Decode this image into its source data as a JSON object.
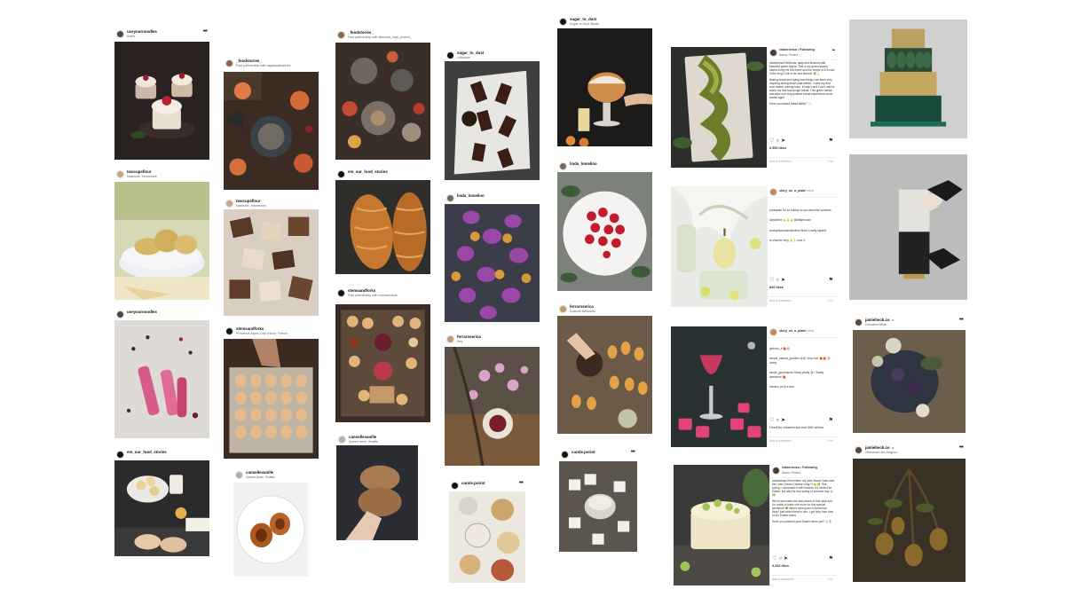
{
  "posts": [
    {
      "user": "useyournoodles",
      "sub": "Kiss's"
    },
    {
      "user": "twocupsflour",
      "sub": "Nashville, Tennessee"
    },
    {
      "user": "useyournoodles",
      "sub": ""
    },
    {
      "user": "em_our_food_stories",
      "sub": ""
    },
    {
      "user": "_foodstories_",
      "sub": "Paid partnership with sagaspatisseries"
    },
    {
      "user": "twocupsflour",
      "sub": "Nashville, Tennessee"
    },
    {
      "user": "stemsandforks",
      "sub": "Provence-Alpes-Côte d'Azur, France"
    },
    {
      "user": "cannellevanille",
      "sub": "Queen Anne, Seattle"
    },
    {
      "user": "_foodstories_",
      "sub": "Paid partnership with alimenta_high_protein_"
    },
    {
      "user": "em_our_food_stories",
      "sub": ""
    },
    {
      "user": "stemsandforks",
      "sub": "Paid partnership with memoemaria"
    },
    {
      "user": "cannellevanille",
      "sub": "Queen Anne, Seattle"
    },
    {
      "user": "sugar_to_dust",
      "sub": "Lithuania"
    },
    {
      "user": "linda_lomelino",
      "sub": ""
    },
    {
      "user": "ferraroserica",
      "sub": "Italy"
    },
    {
      "user": "carole.poirot",
      "sub": ""
    },
    {
      "user": "sugar_to_dust",
      "sub": "Sugar to Dust Studio"
    },
    {
      "user": "linda_lomelino",
      "sub": ""
    },
    {
      "user": "ferraroserica",
      "sub": "Dolomiti Bellunesi"
    },
    {
      "user": "carole.poirot",
      "sub": ""
    },
    {
      "user": "jamiebeck.co",
      "sub": "Domaine Milan"
    },
    {
      "user": "jamiebeck.co",
      "sub": "Villeneuve-lès-Avignon"
    }
  ],
  "panels": {
    "p1": {
      "user": "vidaeriensa • Following",
      "sub": "Ikarea, Finland",
      "caption": "vidaeriensa Delicious, tasty and finished with beautiful green layers. This is my green savory babka lovely for the event and the recipe of it is now in the blog! Link in bio and stories! 🌿🍃",
      "caption2": "Baking bread and trying new things has been very inspiring during these past weeks. I have my first sour starter coming soon, it hasn't and I can't wait to share my first sourdough bread. This green babka was also one very positive bread experience some weeks ago!!",
      "caption3": "Have you baked bread lately? 🤍",
      "likes": "6,555 likes",
      "add": "Add a comment...",
      "post": "Post"
    },
    "p2": {
      "user": "story_on_a_plate",
      "follow": "• Follow",
      "c1": "puresplan So so bubbly so you drew the wonders",
      "c2": "caryitchen 🍐🍐🍐@laflaphouse",
      "c3": "foodaphotoandcollective Wow! Lovely splash!",
      "c4": "ie sharmic Very 🍐👌 love it",
      "likes": "826 likes",
      "add": "Add a comment...",
      "post": "Post"
    },
    "p3": {
      "user": "story_on_a_plate",
      "follow": "• Follow",
      "c1": "gintonic_e 🍓😍",
      "c2": "simple_natural_goodies 😍😍 Very nice 🍓🍓 😘 lovely",
      "c3": "strode_gourmands Really pretty 😍 I Totally awesome 🍓",
      "c4": "heiravo_eu It a love",
      "liked": "Liked by vidaeriensa and 308 others",
      "add": "Add a comment...",
      "post": "Post"
    },
    "p4": {
      "user": "vidaeriensa • Following",
      "sub": "Ikarea, Finland",
      "caption": "vidaeriensa Remember my Lime Bundt Cake with the Lime Cream Cheese Icing?!! 🍋🌿 This spring, I decorated it with flowers. It's perfect for Easter, but also for any spring or summer day 🌸🌿",
      "caption2": "We've just eaten the last pieces of this cake and I'm ready to bake one more for this special weekend! 💚 Who's here good in turned but fizzy? just when there is one. I got help from how of our Easter menu.",
      "caption3": "Have you planned your Easter menu yet? 🐰🌷",
      "likes": "3,333 likes",
      "add": "Add a comment...",
      "post": "Post"
    }
  },
  "colors": {
    "accent": "#3897f0",
    "border": "#efefef"
  }
}
